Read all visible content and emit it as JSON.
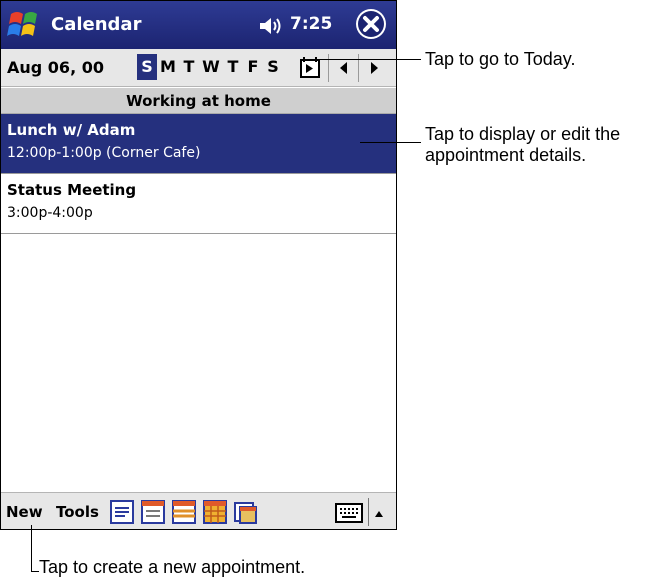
{
  "titlebar": {
    "title": "Calendar",
    "time": "7:25",
    "icons": [
      "windows-start-icon",
      "speaker-icon",
      "close-icon"
    ]
  },
  "datebar": {
    "date": "Aug 06, 00",
    "weekdays": [
      "S",
      "M",
      "T",
      "W",
      "T",
      "F",
      "S"
    ],
    "selected_index": 0
  },
  "all_day_event": "Working at home",
  "appointments": [
    {
      "title": "Lunch w/ Adam",
      "detail": "12:00p-1:00p (Corner Cafe)",
      "selected": true
    },
    {
      "title": "Status Meeting",
      "detail": "3:00p-4:00p",
      "selected": false
    }
  ],
  "toolbar": {
    "new_label": "New",
    "tools_label": "Tools",
    "view_icons": [
      "agenda-view-icon",
      "day-view-icon",
      "week-view-icon",
      "month-view-icon",
      "year-view-icon"
    ]
  },
  "callouts": {
    "today": "Tap to go to Today.",
    "details_line1": "Tap to display or edit the",
    "details_line2": "appointment details.",
    "new": "Tap to create a new appointment."
  },
  "colors": {
    "titlebar": "#25307e",
    "selection": "#25307e",
    "toolbar": "#e7e7e7"
  }
}
